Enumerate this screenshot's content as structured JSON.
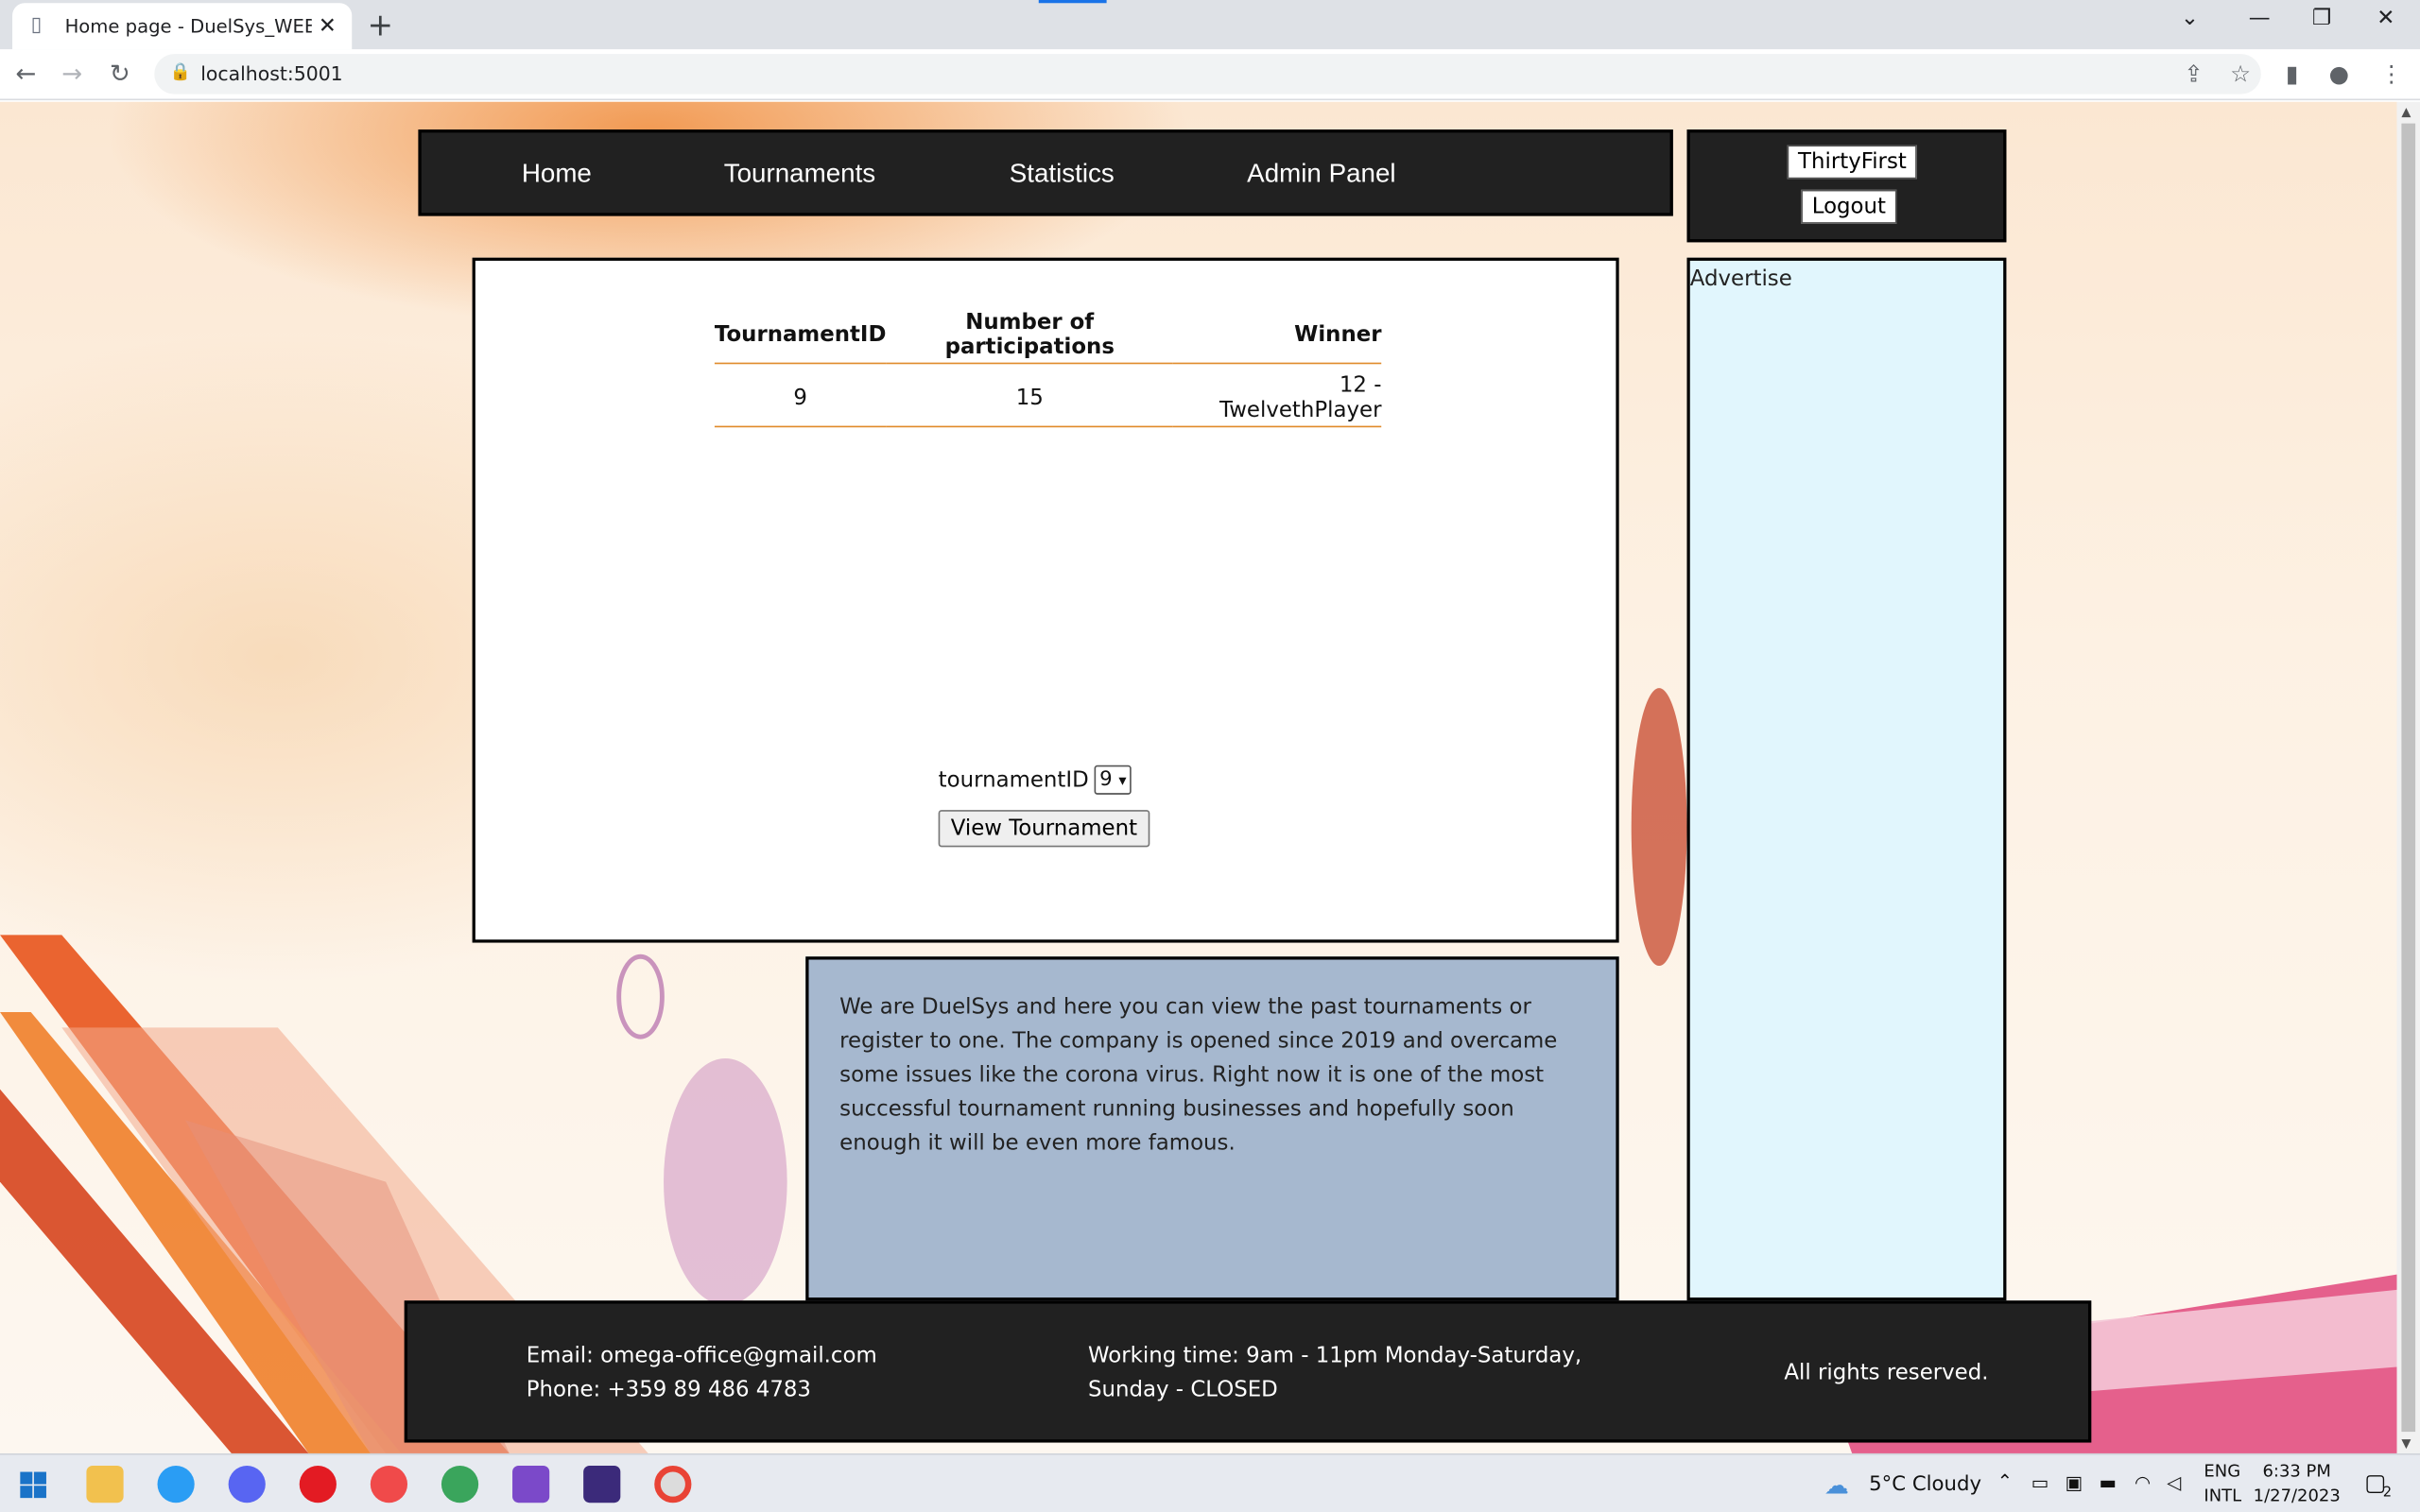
{
  "browser": {
    "tab_title": "Home page - DuelSys_WEB_Appl",
    "url": "localhost:5001"
  },
  "nav": {
    "items": [
      "Home",
      "Tournaments",
      "Statistics",
      "Admin Panel"
    ]
  },
  "user": {
    "username": "ThirtyFirst",
    "logout_label": "Logout"
  },
  "table": {
    "headers": [
      "TournamentID",
      "Number of participations",
      "Winner"
    ],
    "rows": [
      [
        "9",
        "15",
        "12 - TwelvethPlayer"
      ]
    ]
  },
  "selector": {
    "label": "tournamentID",
    "selected": "9",
    "button_label": "View Tournament"
  },
  "about": {
    "text": "We are DuelSys and here you can view the past tournaments or register to one. The company is opened since 2019 and overcame some issues like the corona virus. Right now it is one of the most successful tournament running businesses and hopefully soon enough it will be even more famous."
  },
  "advert": {
    "label": "Advertise"
  },
  "footer": {
    "email": "Email: omega-office@gmail.com",
    "phone": "Phone: +359 89 486 4783",
    "hours_line1": "Working time: 9am - 11pm Monday-Saturday,",
    "hours_line2": "Sunday - CLOSED",
    "rights": "All rights reserved."
  },
  "taskbar": {
    "weather": "5°C  Cloudy",
    "lang1": "ENG",
    "lang2": "INTL",
    "time": "6:33 PM",
    "date": "1/27/2023",
    "notif_count": "2"
  },
  "colors": {
    "nav_bg": "#212121",
    "table_rule": "#e08b2b",
    "about_bg": "#a6b8cf",
    "advert_bg": "#e1f6fd"
  }
}
